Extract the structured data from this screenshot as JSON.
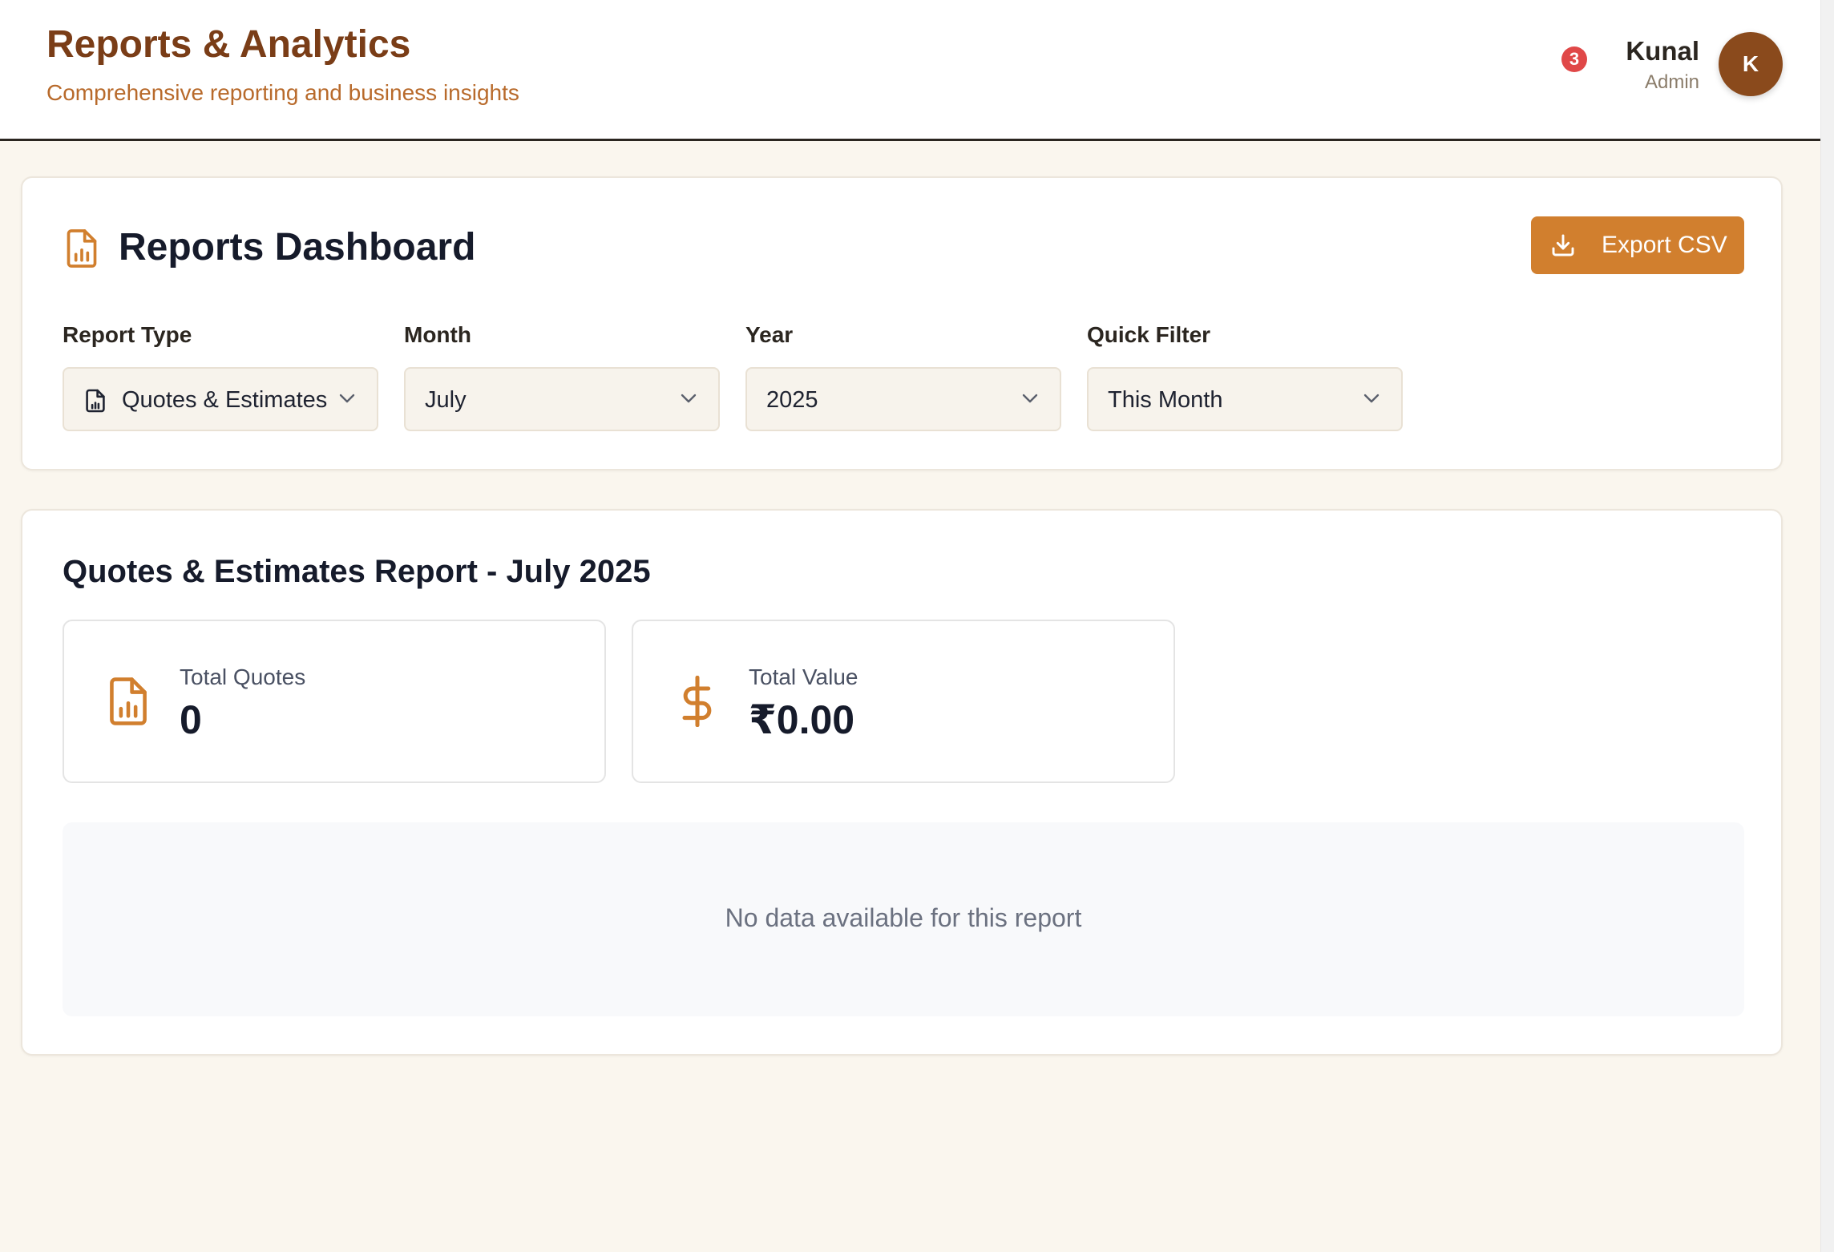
{
  "header": {
    "title": "Reports & Analytics",
    "subtitle": "Comprehensive reporting and business insights",
    "notification_count": "3",
    "user_name": "Kunal",
    "user_role": "Admin",
    "avatar_initial": "K"
  },
  "dashboard": {
    "title": "Reports Dashboard",
    "icon": "document-chart-icon",
    "export_label": "Export CSV"
  },
  "filters": {
    "report_type": {
      "label": "Report Type",
      "value": "Quotes & Estimates"
    },
    "month": {
      "label": "Month",
      "value": "July"
    },
    "year": {
      "label": "Year",
      "value": "2025"
    },
    "quick_filter": {
      "label": "Quick Filter",
      "value": "This Month"
    }
  },
  "report": {
    "title": "Quotes & Estimates Report - July 2025",
    "stats": [
      {
        "label": "Total Quotes",
        "value": "0",
        "icon": "document-chart-icon"
      },
      {
        "label": "Total Value",
        "value": "₹0.00",
        "icon": "dollar-icon"
      }
    ],
    "empty_message": "No data available for this report"
  },
  "colors": {
    "accent": "#d17f2e",
    "title_brown": "#7a3d17",
    "background": "#faf6ee"
  }
}
